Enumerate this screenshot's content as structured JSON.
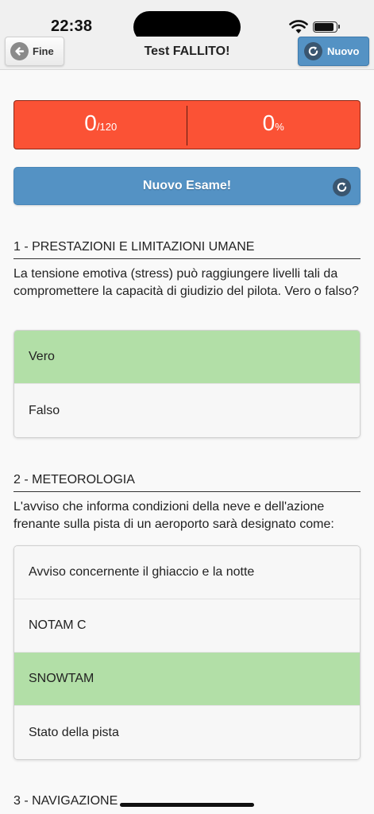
{
  "status_bar": {
    "time": "22:38"
  },
  "header": {
    "back_label": "Fine",
    "title": "Test FALLITO!",
    "new_label": "Nuovo"
  },
  "score": {
    "correct": "0",
    "total": "/120",
    "percent": "0",
    "percent_sign": "%"
  },
  "new_exam_button": "Nuovo Esame!",
  "questions": [
    {
      "title": "1 - PRESTAZIONI E LIMITAZIONI UMANE",
      "text": "La tensione emotiva (stress) può raggiungere livelli tali da compromettere la capacità di giudizio del pilota. Vero o falso?",
      "answers": [
        "Vero",
        "Falso"
      ],
      "correct_index": 0
    },
    {
      "title": "2 - METEOROLOGIA",
      "text": "L'avviso che informa condizioni della neve e dell'azione frenante sulla pista di un aeroporto sarà designato come:",
      "answers": [
        "Avviso concernente il ghiaccio e la notte",
        "NOTAM C",
        "SNOWTAM",
        "Stato della pista"
      ],
      "correct_index": 2
    },
    {
      "title": "3 - NAVIGAZIONE"
    }
  ],
  "colors": {
    "fail_red": "#fb5235",
    "accent_blue": "#5492c4",
    "correct_green": "#b2dfa7"
  },
  "icons": {
    "back": "arrow-left-icon",
    "refresh": "refresh-icon",
    "wifi": "wifi-icon",
    "battery": "battery-icon"
  }
}
